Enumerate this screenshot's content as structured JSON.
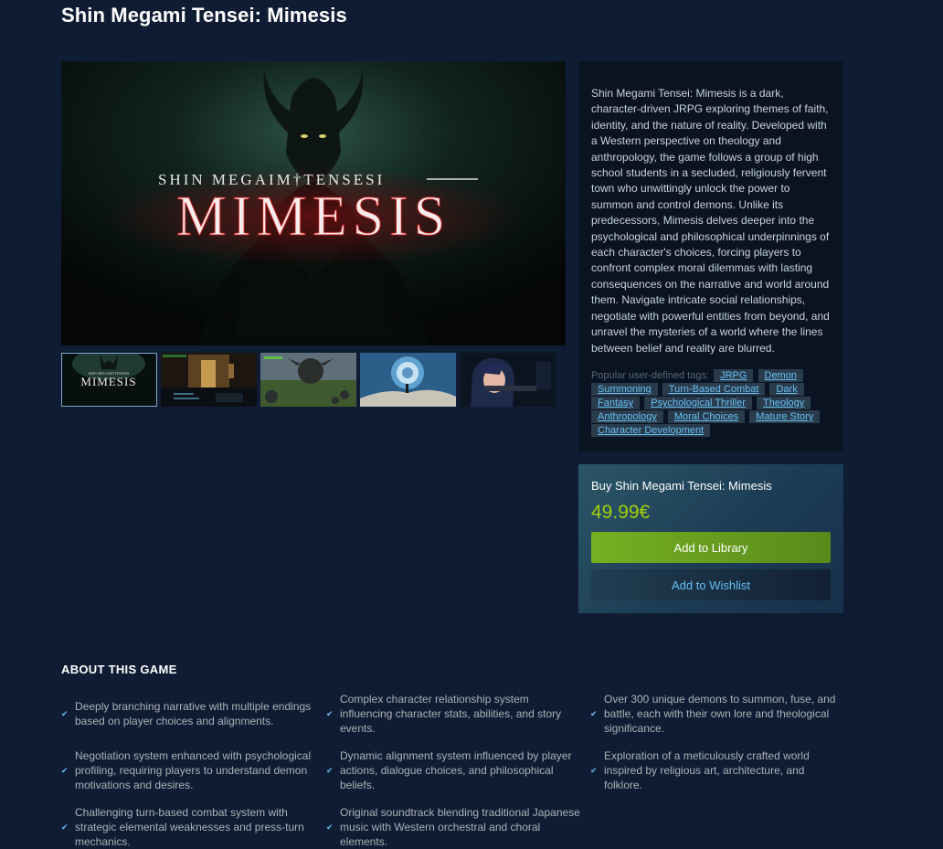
{
  "page": {
    "title": "Shin Megami Tensei: Mimesis"
  },
  "media": {
    "hero_logo_subtitle": "SHIN MEGAIM†TENSESI",
    "hero_logo_title": "MIMESIS",
    "thumb_logo_subtitle": "SHIN MEGAIM†TENSESI",
    "thumb_logo_title": "MIMESIS"
  },
  "description": {
    "text": "Shin Megami Tensei: Mimesis is a dark, character-driven JRPG exploring themes of faith, identity, and the nature of reality. Developed with a Western perspective on theology and anthropology, the game follows a group of high school students in a secluded, religiously fervent town who unwittingly unlock the power to summon and control demons. Unlike its predecessors, Mimesis delves deeper into the psychological and philosophical underpinnings of each character's choices, forcing players to confront complex moral dilemmas with lasting consequences on the narrative and world around them. Navigate intricate social relationships, negotiate with powerful entities from beyond, and unravel the mysteries of a world where the lines between belief and reality are blurred.",
    "tags_label": "Popular user-defined tags:",
    "tags": [
      "JRPG",
      "Demon Summoning",
      "Turn-Based Combat",
      "Dark Fantasy",
      "Psychological Thriller",
      "Theology",
      "Anthropology",
      "Moral Choices",
      "Mature Story",
      "Character Development"
    ]
  },
  "purchase": {
    "title": "Buy Shin Megami Tensei: Mimesis",
    "price": "49.99€",
    "add_to_library": "Add to Library",
    "add_to_wishlist": "Add to Wishlist"
  },
  "about": {
    "heading": "ABOUT THIS GAME",
    "check_icon": "✔",
    "features": [
      "Deeply branching narrative with multiple endings based on player choices and alignments.",
      "Complex character relationship system influencing character stats, abilities, and story events.",
      "Over 300 unique demons to summon, fuse, and battle, each with their own lore and theological significance.",
      "Negotiation system enhanced with psychological profiling, requiring players to understand demon motivations and desires.",
      "Dynamic alignment system influenced by player actions, dialogue choices, and philosophical beliefs.",
      "Exploration of a meticulously crafted world inspired by religious art, architecture, and folklore.",
      "Challenging turn-based combat system with strategic elemental weaknesses and press-turn mechanics.",
      "Original soundtrack blending traditional Japanese music with Western orchestral and choral elements."
    ]
  },
  "colors": {
    "background": "#0f1c33",
    "price_green": "#a4d007",
    "link_blue": "#67c1f5",
    "library_button": "#75b022"
  }
}
